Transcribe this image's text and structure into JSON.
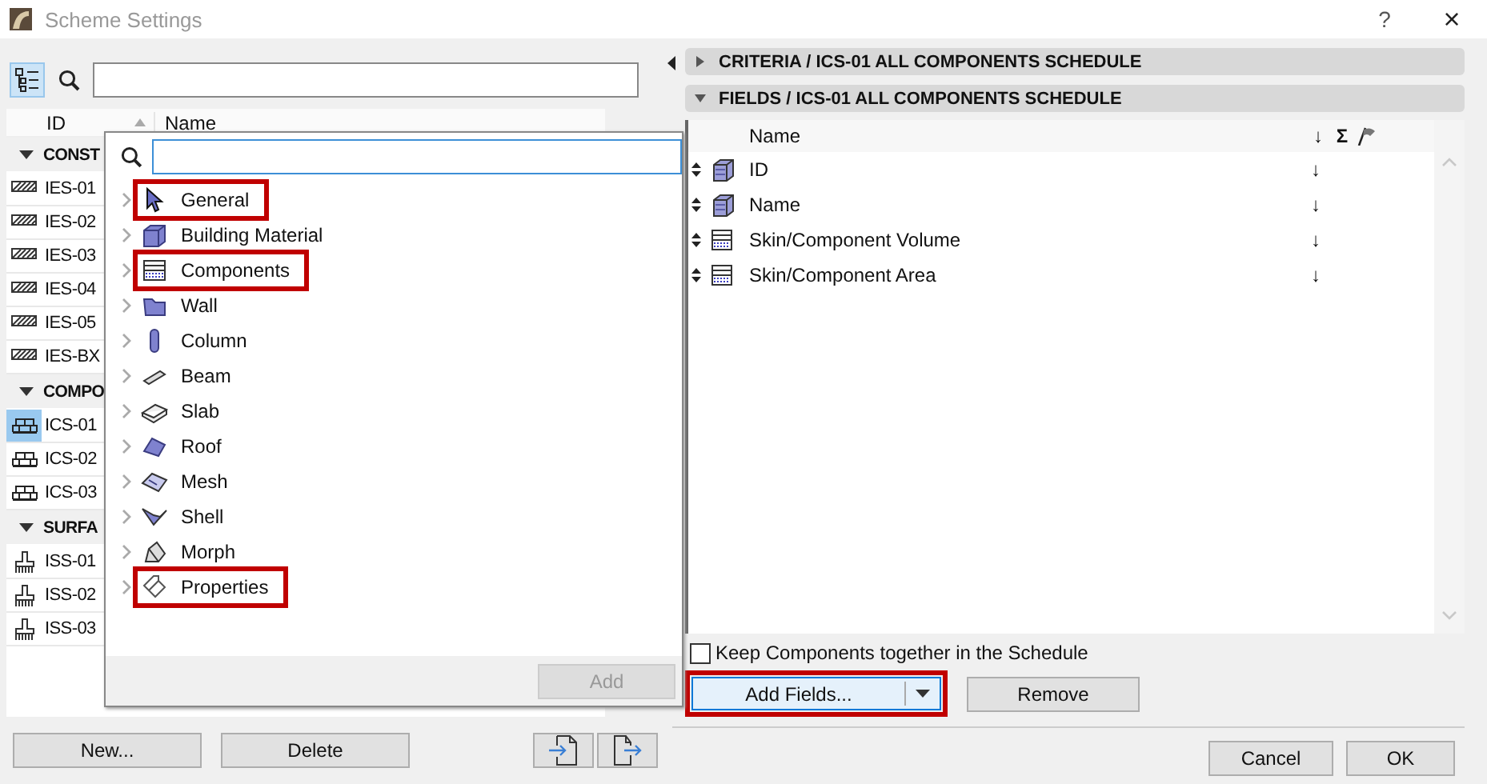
{
  "window": {
    "title": "Scheme Settings",
    "help": "?",
    "close": "×"
  },
  "scheme_list": {
    "columns": [
      "ID",
      "Name"
    ],
    "groups": [
      {
        "label": "CONST",
        "expanded": true,
        "items": [
          {
            "id": "IES-01",
            "selected": false
          },
          {
            "id": "IES-02",
            "selected": false
          },
          {
            "id": "IES-03",
            "selected": false
          },
          {
            "id": "IES-04",
            "selected": false
          },
          {
            "id": "IES-05",
            "selected": false
          },
          {
            "id": "IES-BX",
            "selected": false
          }
        ]
      },
      {
        "label": "COMPO",
        "expanded": true,
        "items": [
          {
            "id": "ICS-01",
            "selected": true
          },
          {
            "id": "ICS-02",
            "selected": false
          },
          {
            "id": "ICS-03",
            "selected": false
          }
        ]
      },
      {
        "label": "SURFA",
        "expanded": true,
        "items": [
          {
            "id": "ISS-01",
            "selected": false
          },
          {
            "id": "ISS-02",
            "selected": false
          },
          {
            "id": "ISS-03",
            "selected": false
          }
        ]
      }
    ],
    "buttons": [
      "New...",
      "Delete"
    ]
  },
  "field_picker": {
    "items": [
      {
        "label": "General",
        "highlighted": true
      },
      {
        "label": "Building Material",
        "highlighted": false
      },
      {
        "label": "Components",
        "highlighted": true
      },
      {
        "label": "Wall",
        "highlighted": false
      },
      {
        "label": "Column",
        "highlighted": false
      },
      {
        "label": "Beam",
        "highlighted": false
      },
      {
        "label": "Slab",
        "highlighted": false
      },
      {
        "label": "Roof",
        "highlighted": false
      },
      {
        "label": "Mesh",
        "highlighted": false
      },
      {
        "label": "Shell",
        "highlighted": false
      },
      {
        "label": "Morph",
        "highlighted": false
      },
      {
        "label": "Properties",
        "highlighted": true
      }
    ],
    "add_button": {
      "label": "Add",
      "disabled": true
    }
  },
  "sections": [
    {
      "title": "CRITERIA / ICS-01 ALL COMPONENTS SCHEDULE",
      "expanded": false
    },
    {
      "title": "FIELDS / ICS-01 ALL COMPONENTS SCHEDULE",
      "expanded": true
    }
  ],
  "fields_table": {
    "columns": {
      "name": "Name",
      "sort": "↓",
      "sum": "Σ"
    },
    "rows": [
      {
        "name": "ID",
        "kind": "element",
        "sort": "↓"
      },
      {
        "name": "Name",
        "kind": "element",
        "sort": "↓"
      },
      {
        "name": "Skin/Component Volume",
        "kind": "component",
        "sort": "↓"
      },
      {
        "name": "Skin/Component Area",
        "kind": "component",
        "sort": "↓"
      }
    ]
  },
  "keep_together": {
    "label": "Keep Components together in the Schedule",
    "checked": false
  },
  "add_fields_button": {
    "label": "Add Fields...",
    "highlighted": true
  },
  "remove_button": "Remove",
  "dialog_buttons": [
    "Cancel",
    "OK"
  ]
}
